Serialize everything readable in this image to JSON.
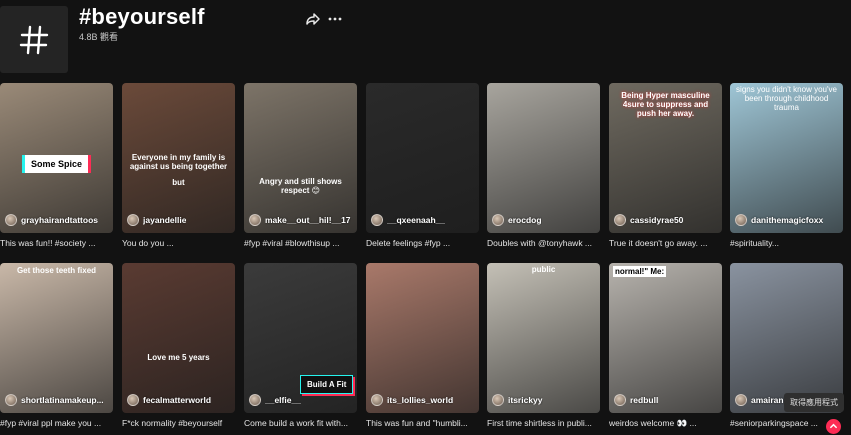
{
  "header": {
    "title": "#beyourself",
    "views": "4.8B 觀看",
    "share_icon": "share-arrow-icon",
    "more_icon": "ellipsis-icon"
  },
  "videos": [
    {
      "user": "grayhairandtattoos",
      "caption": "This was fun!! #society ...",
      "overlay": "Some Spice",
      "overlay_style": "box-white",
      "bg": "#9a8a78"
    },
    {
      "user": "jayandellie",
      "caption": "You do you ...",
      "overlay": "Everyone in my family is against us being together",
      "overlay2": "but",
      "bg": "#6b4a3a"
    },
    {
      "user": "make__out__hil!__17",
      "caption": "#fyp #viral #blowthisup ...",
      "overlay": "Angry and still shows respect 😊",
      "bg": "#7d7468"
    },
    {
      "user": "__qxeenaah__",
      "caption": "Delete feelings #fyp ...",
      "bg": "#2a2a2a"
    },
    {
      "user": "erocdog",
      "caption": "Doubles with @tonyhawk ...",
      "bg": "#a8a59e"
    },
    {
      "user": "cassidyrae50",
      "caption": "True it doesn't go away. ...",
      "overlay": "Being Hyper masculine 4sure to suppress and push her away.",
      "bg": "#6f6a60"
    },
    {
      "user": "danithemagicfoxx",
      "caption": "#spirituality...",
      "overlay": "signs you didn't know you've been through childhood trauma",
      "bg": "#9fc6d6"
    },
    {
      "user": "shortlatinamakeup...",
      "caption": "#fyp #viral ppl make you ...",
      "overlay": "Get those teeth fixed",
      "bg": "#c9b8a8"
    },
    {
      "user": "fecalmatterworld",
      "caption": "F*ck normality #beyourself",
      "overlay": "Love me 5 years",
      "bg": "#5a3b32"
    },
    {
      "user": "__elfie__",
      "caption": "Come build a work fit with...",
      "overlay": "Build A Fit",
      "overlay_style": "box-dark",
      "bg": "#3b3b3b"
    },
    {
      "user": "its_lollies_world",
      "caption": "This was fun and \"humbli...",
      "bg": "#a9796a"
    },
    {
      "user": "itsrickyy",
      "caption": "First time shirtless in publi...",
      "overlay": "public",
      "bg": "#c4c0b6"
    },
    {
      "user": "redbull",
      "caption": "weirdos welcome 👀 ...",
      "overlay": "normal!\" Me:",
      "bg": "#b7b3ad"
    },
    {
      "user": "amairani",
      "caption": "#seniorparkingspace ...",
      "bg": "#8a93a0"
    }
  ],
  "get_app": "取得應用程式",
  "colors": {
    "accent": "#fe2c55",
    "background": "#121212"
  }
}
